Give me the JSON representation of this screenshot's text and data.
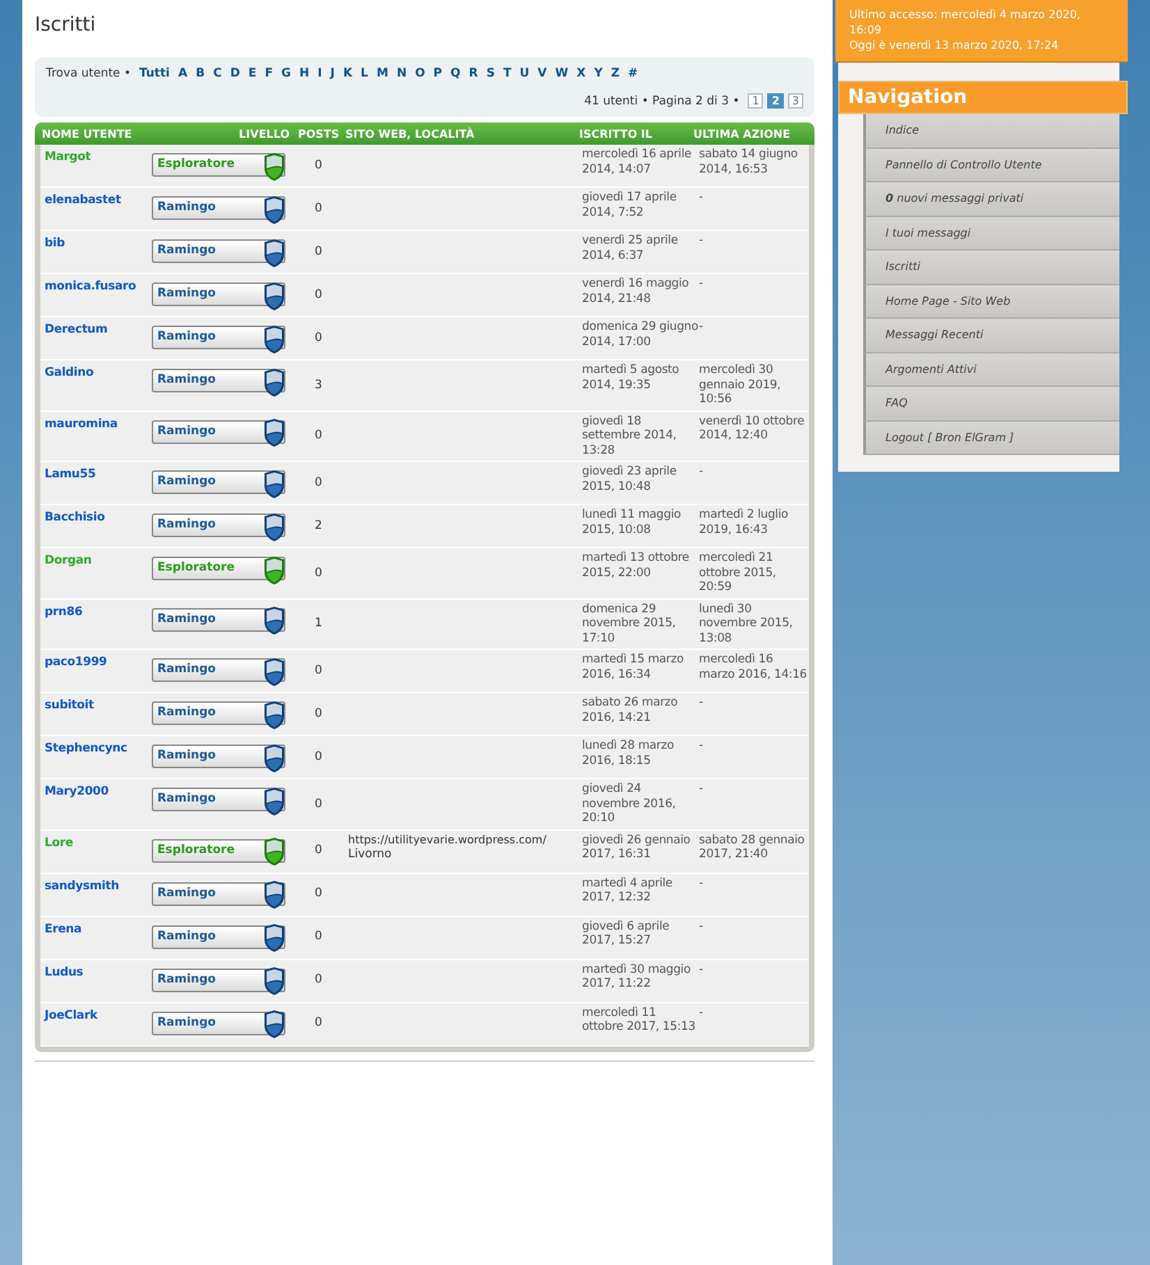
{
  "page_title": "Iscritti",
  "finder": {
    "label": "Trova utente •",
    "all": "Tutti",
    "letters": [
      "A",
      "B",
      "C",
      "D",
      "E",
      "F",
      "G",
      "H",
      "I",
      "J",
      "K",
      "L",
      "M",
      "N",
      "O",
      "P",
      "Q",
      "R",
      "S",
      "T",
      "U",
      "V",
      "W",
      "X",
      "Y",
      "Z",
      "#"
    ]
  },
  "pagination": {
    "summary": "41 utenti • Pagina 2 di 3 •",
    "pages": [
      {
        "label": "1",
        "selected": false
      },
      {
        "label": "2",
        "selected": true
      },
      {
        "label": "3",
        "selected": false
      }
    ]
  },
  "table": {
    "columns": [
      "NOME UTENTE",
      "LIVELLO",
      "POSTS",
      "SITO WEB, LOCALITÀ",
      "ISCRITTO IL",
      "ULTIMA AZIONE"
    ],
    "rows": [
      {
        "name": "Margot",
        "rank": {
          "label": "Esploratore",
          "kind": "explorer"
        },
        "posts": "0",
        "joined": "mercoledì 16 aprile 2014, 14:07",
        "last": "sabato 14 giugno 2014, 16:53"
      },
      {
        "name": "elenabastet",
        "rank": {
          "label": "Ramingo",
          "kind": "ranger"
        },
        "posts": "0",
        "joined": "giovedì 17 aprile 2014, 7:52",
        "last": "-"
      },
      {
        "name": "bib",
        "rank": {
          "label": "Ramingo",
          "kind": "ranger"
        },
        "posts": "0",
        "joined": "venerdì 25 aprile 2014, 6:37",
        "last": "-"
      },
      {
        "name": "monica.fusaro",
        "rank": {
          "label": "Ramingo",
          "kind": "ranger"
        },
        "posts": "0",
        "joined": "venerdì 16 maggio 2014, 21:48",
        "last": "-"
      },
      {
        "name": "Derectum",
        "rank": {
          "label": "Ramingo",
          "kind": "ranger"
        },
        "posts": "0",
        "joined": "domenica 29 giugno 2014, 17:00",
        "last": "-"
      },
      {
        "name": "Galdino",
        "rank": {
          "label": "Ramingo",
          "kind": "ranger"
        },
        "posts": "3",
        "joined": "martedì 5 agosto 2014, 19:35",
        "last": "mercoledì 30 gennaio 2019, 10:56"
      },
      {
        "name": "mauromina",
        "rank": {
          "label": "Ramingo",
          "kind": "ranger"
        },
        "posts": "0",
        "joined": "giovedì 18 settembre 2014, 13:28",
        "last": "venerdì 10 ottobre 2014, 12:40"
      },
      {
        "name": "Lamu55",
        "rank": {
          "label": "Ramingo",
          "kind": "ranger"
        },
        "posts": "0",
        "joined": "giovedì 23 aprile 2015, 10:48",
        "last": "-"
      },
      {
        "name": "Bacchisio",
        "rank": {
          "label": "Ramingo",
          "kind": "ranger"
        },
        "posts": "2",
        "joined": "lunedì 11 maggio 2015, 10:08",
        "last": "martedì 2 luglio 2019, 16:43"
      },
      {
        "name": "Dorgan",
        "rank": {
          "label": "Esploratore",
          "kind": "explorer"
        },
        "posts": "0",
        "joined": "martedì 13 ottobre 2015, 22:00",
        "last": "mercoledì 21 ottobre 2015, 20:59"
      },
      {
        "name": "prn86",
        "rank": {
          "label": "Ramingo",
          "kind": "ranger"
        },
        "posts": "1",
        "joined": "domenica 29 novembre 2015, 17:10",
        "last": "lunedì 30 novembre 2015, 13:08"
      },
      {
        "name": "paco1999",
        "rank": {
          "label": "Ramingo",
          "kind": "ranger"
        },
        "posts": "0",
        "joined": "martedì 15 marzo 2016, 16:34",
        "last": "mercoledì 16 marzo 2016, 14:16"
      },
      {
        "name": "subitoit",
        "rank": {
          "label": "Ramingo",
          "kind": "ranger"
        },
        "posts": "0",
        "joined": "sabato 26 marzo 2016, 14:21",
        "last": "-"
      },
      {
        "name": "Stephencync",
        "rank": {
          "label": "Ramingo",
          "kind": "ranger"
        },
        "posts": "0",
        "joined": "lunedì 28 marzo 2016, 18:15",
        "last": "-"
      },
      {
        "name": "Mary2000",
        "rank": {
          "label": "Ramingo",
          "kind": "ranger"
        },
        "posts": "0",
        "joined": "giovedì 24 novembre 2016, 20:10",
        "last": "-"
      },
      {
        "name": "Lore",
        "rank": {
          "label": "Esploratore",
          "kind": "explorer"
        },
        "posts": "0",
        "website": "https://utilityevarie.wordpress.com/",
        "location": "Livorno",
        "joined": "giovedì 26 gennaio 2017, 16:31",
        "last": "sabato 28 gennaio 2017, 21:40"
      },
      {
        "name": "sandysmith",
        "rank": {
          "label": "Ramingo",
          "kind": "ranger"
        },
        "posts": "0",
        "joined": "martedì 4 aprile 2017, 12:32",
        "last": "-"
      },
      {
        "name": "Erena",
        "rank": {
          "label": "Ramingo",
          "kind": "ranger"
        },
        "posts": "0",
        "joined": "giovedì 6 aprile 2017, 15:27",
        "last": "-"
      },
      {
        "name": "Ludus",
        "rank": {
          "label": "Ramingo",
          "kind": "ranger"
        },
        "posts": "0",
        "joined": "martedì 30 maggio 2017, 11:22",
        "last": "-"
      },
      {
        "name": "JoeClark",
        "rank": {
          "label": "Ramingo",
          "kind": "ranger"
        },
        "posts": "0",
        "joined": "mercoledì 11 ottobre 2017, 15:13",
        "last": "-"
      }
    ]
  },
  "session": {
    "last_visit": "Ultimo accesso: mercoledì 4 marzo 2020, 16:09",
    "today": "Oggi è venerdì 13 marzo 2020, 17:24"
  },
  "navigation": {
    "title": "Navigation",
    "items": [
      "Indice",
      "Pannello di Controllo Utente",
      "**0** nuovi messaggi privati",
      "I tuoi messaggi",
      "Iscritti",
      "Home Page - Sito Web",
      "Messaggi Recenti",
      "Argomenti Attivi",
      "FAQ",
      "Logout [ Bron ElGram ]"
    ]
  }
}
